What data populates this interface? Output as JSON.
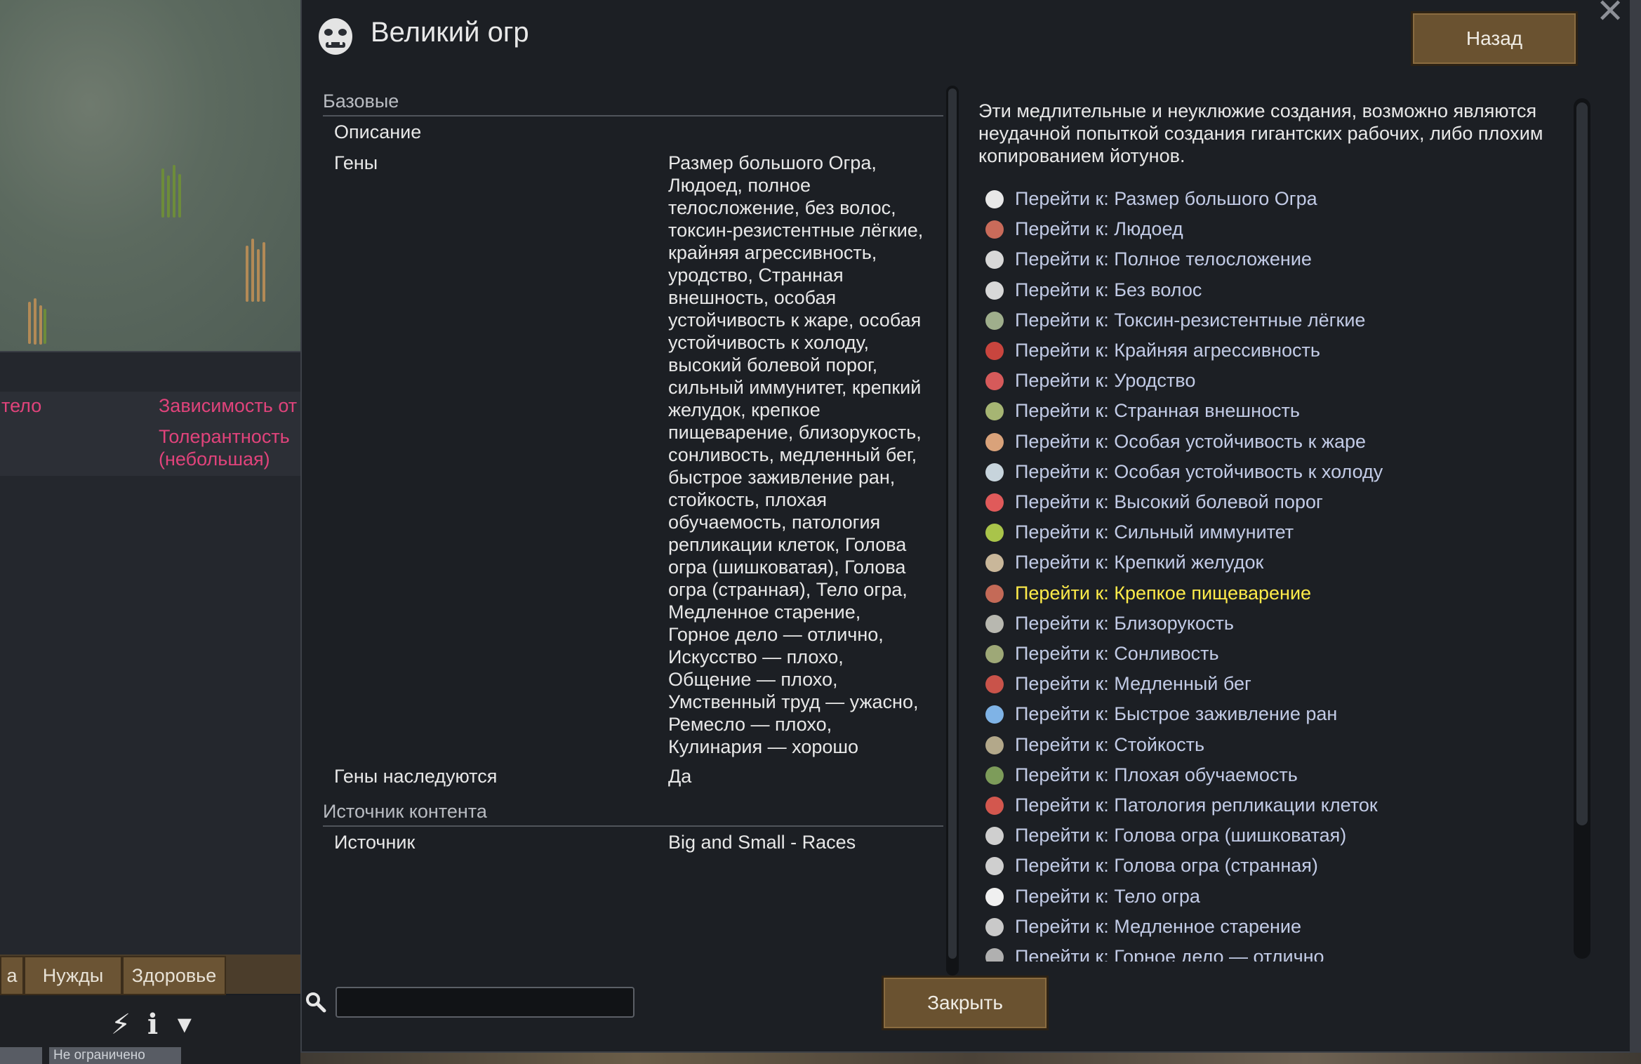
{
  "window": {
    "title": "Великий огр",
    "back_label": "Назад",
    "close_label": "Закрыть",
    "close_x": "✕"
  },
  "stats": {
    "section_basic": "Базовые",
    "description_label": "Описание",
    "genes_label": "Гены",
    "genes_value": "Размер большого Огра,\nЛюдоед, полное\nтелосложение, без волос,\nтоксин-резистентные лёгкие,\nкрайняя агрессивность,\nуродство, Странная\nвнешность, особая\nустойчивость к жаре, особая\nустойчивость к холоду,\nвысокий болевой порог,\nсильный иммунитет, крепкий\nжелудок, крепкое\nпищеварение, близорукость,\nсонливость, медленный бег,\nбыстрое заживление ран,\nстойкость, плохая\nобучаемость, патология\nрепликации клеток, Голова\nогра (шишковатая), Голова\nогра (странная), Тело огра,\nМедленное старение,\nГорное дело — отлично,\nИскусство — плохо,\nОбщение — плохо,\nУмственный труд — ужасно,\nРемесло — плохо,\nКулинария — хорошо",
    "inherited_label": "Гены наследуются",
    "inherited_value": "Да",
    "section_source": "Источник контента",
    "source_label": "Источник",
    "source_value": "Big and Small - Races"
  },
  "description": "Эти медлительные и неуклюжие создания, возможно являются неудачной попыткой создания гигантских рабочих, либо плохим копированием йотунов.",
  "links": [
    {
      "text": "Перейти к: Размер большого Огра",
      "icon": "ogre-size-icon",
      "color": "#e8e8e8"
    },
    {
      "text": "Перейти к: Людоед",
      "icon": "drumstick-icon",
      "color": "#c96b5a"
    },
    {
      "text": "Перейти к: Полное телосложение",
      "icon": "fat-body-icon",
      "color": "#d8d8d8"
    },
    {
      "text": "Перейти к: Без волос",
      "icon": "bald-head-icon",
      "color": "#d8d8d8"
    },
    {
      "text": "Перейти к: Токсин-резистентные лёгкие",
      "icon": "lungs-icon",
      "color": "#9fae8c"
    },
    {
      "text": "Перейти к: Крайняя агрессивность",
      "icon": "aggression-icon",
      "color": "#c9453e"
    },
    {
      "text": "Перейти к: Уродство",
      "icon": "ugly-face-icon",
      "color": "#d65a5a"
    },
    {
      "text": "Перейти к: Странная внешность",
      "icon": "strange-face-icon",
      "color": "#a6b573"
    },
    {
      "text": "Перейти к: Особая устойчивость к жаре",
      "icon": "thermometer-hot-icon",
      "color": "#d9a27a"
    },
    {
      "text": "Перейти к: Особая устойчивость к холоду",
      "icon": "thermometer-cold-icon",
      "color": "#c7d4dc"
    },
    {
      "text": "Перейти к: Высокий болевой порог",
      "icon": "pain-icon",
      "color": "#e05a5a"
    },
    {
      "text": "Перейти к: Сильный иммунитет",
      "icon": "immunity-icon",
      "color": "#a9c44a"
    },
    {
      "text": "Перейти к: Крепкий желудок",
      "icon": "stomach-icon",
      "color": "#c9b79a"
    },
    {
      "text": "Перейти к: Крепкое пищеварение",
      "icon": "digestion-icon",
      "color": "#c46a57"
    },
    {
      "text": "Перейти к: Близорукость",
      "icon": "eye-icon",
      "color": "#b8b8b0"
    },
    {
      "text": "Перейти к: Сонливость",
      "icon": "sleep-icon",
      "color": "#9ea877"
    },
    {
      "text": "Перейти к: Медленный бег",
      "icon": "slow-runner-icon",
      "color": "#c9534a"
    },
    {
      "text": "Перейти к: Быстрое заживление ран",
      "icon": "healing-icon",
      "color": "#7fb3e6"
    },
    {
      "text": "Перейти к: Стойкость",
      "icon": "tower-icon",
      "color": "#b3a88a"
    },
    {
      "text": "Перейти к: Плохая обучаемость",
      "icon": "graduation-cap-icon",
      "color": "#7d9c5a"
    },
    {
      "text": "Перейти к: Патология репликации клеток",
      "icon": "cell-icon",
      "color": "#d3574e"
    },
    {
      "text": "Перейти к: Голова огра (шишковатая)",
      "icon": "ogre-head-lumpy-icon",
      "color": "#cfcfcf"
    },
    {
      "text": "Перейти к: Голова огра (странная)",
      "icon": "ogre-head-strange-icon",
      "color": "#cfcfcf"
    },
    {
      "text": "Перейти к: Тело огра",
      "icon": "ogre-body-icon",
      "color": "#f0f0f0"
    },
    {
      "text": "Перейти к: Медленное старение",
      "icon": "slow-aging-icon",
      "color": "#c9c9c9"
    },
    {
      "text": "Перейти к: Горное дело — отлично",
      "icon": "pickaxe-icon",
      "color": "#b0b0b0"
    }
  ],
  "highlighted_link_index": 13,
  "search": {
    "value": "",
    "placeholder": ""
  },
  "background": {
    "row_label_1": "тело",
    "row_value_1": "Зависимость от",
    "row_value_2": "Толерантность",
    "row_value_3": "(небольшая)",
    "tabs": [
      "а",
      "Нужды",
      "Здоровье"
    ],
    "status": "Не ограничено"
  },
  "colors": {
    "link": "#c2cbe6",
    "link_highlight": "#ffec4a",
    "warning_pink": "#e0437b",
    "button": "#6a5230"
  }
}
